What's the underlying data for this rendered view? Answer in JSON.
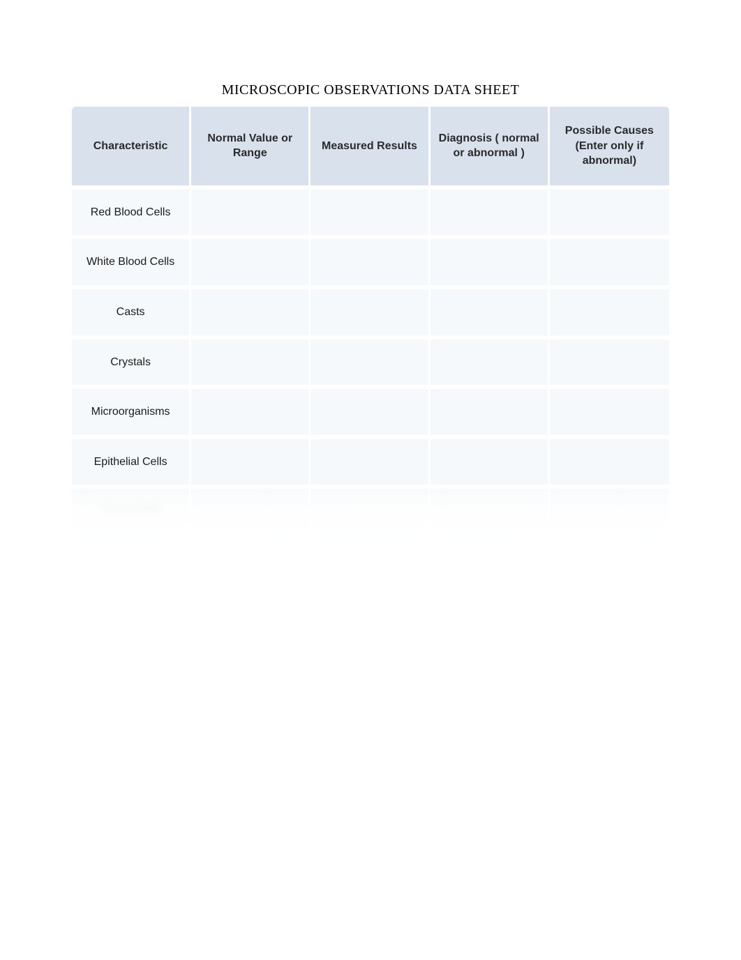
{
  "title": "MICROSCOPIC OBSERVATIONS DATA SHEET",
  "headers": {
    "col1": "Characteristic",
    "col2": "Normal Value or Range",
    "col3": "Measured Results",
    "col4": "Diagnosis ( normal or abnormal )",
    "col5": "Possible Causes (Enter only if abnormal)"
  },
  "rows": [
    {
      "characteristic": "Red Blood Cells",
      "normal_value": "",
      "measured": "",
      "diagnosis": "",
      "causes": ""
    },
    {
      "characteristic": "White Blood Cells",
      "normal_value": "",
      "measured": "",
      "diagnosis": "",
      "causes": ""
    },
    {
      "characteristic": "Casts",
      "normal_value": "",
      "measured": "",
      "diagnosis": "",
      "causes": ""
    },
    {
      "characteristic": "Crystals",
      "normal_value": "",
      "measured": "",
      "diagnosis": "",
      "causes": ""
    },
    {
      "characteristic": "Microorganisms",
      "normal_value": "",
      "measured": "",
      "diagnosis": "",
      "causes": ""
    },
    {
      "characteristic": "Epithelial Cells",
      "normal_value": "",
      "measured": "",
      "diagnosis": "",
      "causes": ""
    },
    {
      "characteristic": "Tumor Cells",
      "normal_value": "",
      "measured": "",
      "diagnosis": "",
      "causes": ""
    }
  ]
}
